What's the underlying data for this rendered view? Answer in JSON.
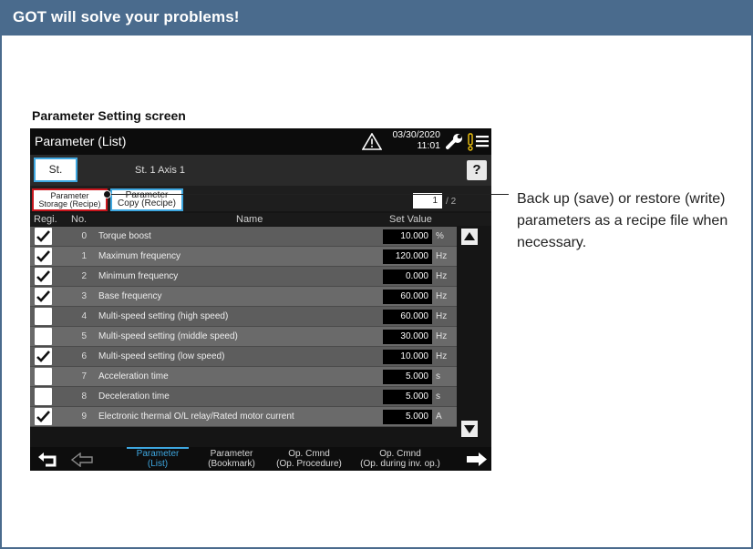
{
  "header": {
    "title": "GOT will solve your problems!"
  },
  "caption": "Parameter Setting screen",
  "panel": {
    "title": "Parameter (List)",
    "date": "03/30/2020",
    "time": "11:01",
    "st_button": "St.",
    "st_label": "St. 1  Axis 1",
    "help": "?",
    "recipe_storage": {
      "line1": "Parameter",
      "line2": "Storage (Recipe)"
    },
    "recipe_copy": {
      "line1": "Parameter",
      "line2": "Copy (Recipe)"
    },
    "page_current": "1",
    "page_total": "2",
    "columns": {
      "regi": "Regi.",
      "no": "No.",
      "name": "Name",
      "set_value": "Set Value"
    },
    "rows": [
      {
        "checked": true,
        "no": "0",
        "name": "Torque boost",
        "value": "10.000",
        "unit": "%"
      },
      {
        "checked": true,
        "no": "1",
        "name": "Maximum frequency",
        "value": "120.000",
        "unit": "Hz"
      },
      {
        "checked": true,
        "no": "2",
        "name": "Minimum frequency",
        "value": "0.000",
        "unit": "Hz"
      },
      {
        "checked": true,
        "no": "3",
        "name": "Base frequency",
        "value": "60.000",
        "unit": "Hz"
      },
      {
        "checked": false,
        "no": "4",
        "name": "Multi-speed setting (high speed)",
        "value": "60.000",
        "unit": "Hz"
      },
      {
        "checked": false,
        "no": "5",
        "name": "Multi-speed setting (middle speed)",
        "value": "30.000",
        "unit": "Hz"
      },
      {
        "checked": true,
        "no": "6",
        "name": "Multi-speed setting (low speed)",
        "value": "10.000",
        "unit": "Hz"
      },
      {
        "checked": false,
        "no": "7",
        "name": "Acceleration time",
        "value": "5.000",
        "unit": "s"
      },
      {
        "checked": false,
        "no": "8",
        "name": "Deceleration time",
        "value": "5.000",
        "unit": "s"
      },
      {
        "checked": true,
        "no": "9",
        "name": "Electronic thermal O/L relay/Rated motor current",
        "value": "5.000",
        "unit": "A"
      }
    ],
    "nav": {
      "tab1": {
        "line1": "Parameter",
        "line2": "(List)"
      },
      "tab2": {
        "line1": "Parameter",
        "line2": "(Bookmark)"
      },
      "tab3": {
        "line1": "Op. Cmnd",
        "line2": "(Op. Procedure)"
      },
      "tab4": {
        "line1": "Op. Cmnd",
        "line2": "(Op. during inv. op.)"
      }
    }
  },
  "callout": "Back up (save) or restore (write) parameters as a recipe file when necessary.",
  "colors": {
    "header": "#4a6b8d",
    "accent": "#3ea7e0",
    "highlight": "#c8161d",
    "warning": "#f1c40f"
  },
  "icons": [
    "warning-icon",
    "wrench-icon",
    "alarm-icon",
    "menu-icon",
    "checkmark-icon",
    "arrow-up-icon",
    "arrow-down-icon",
    "return-icon",
    "arrow-left-icon",
    "arrow-right-icon"
  ]
}
